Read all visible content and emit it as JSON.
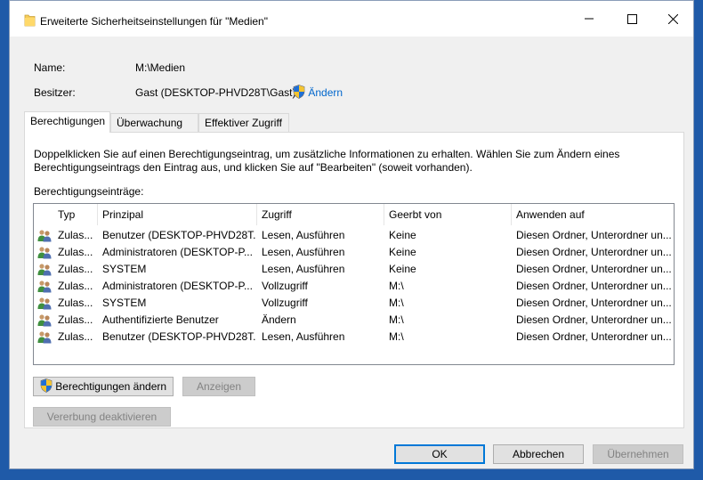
{
  "window": {
    "title": "Erweiterte Sicherheitseinstellungen für \"Medien\""
  },
  "info": {
    "name_label": "Name:",
    "name_value": "M:\\Medien",
    "owner_label": "Besitzer:",
    "owner_value": "Gast (DESKTOP-PHVD28T\\Gast)",
    "change_link": "Ändern"
  },
  "tabs": [
    {
      "label": "Berechtigungen",
      "active": true
    },
    {
      "label": "Überwachung",
      "active": false
    },
    {
      "label": "Effektiver Zugriff",
      "active": false
    }
  ],
  "description": {
    "line1": "Doppelklicken Sie auf einen Berechtigungseintrag, um zusätzliche Informationen zu erhalten. Wählen Sie zum Ändern eines",
    "line2": "Berechtigungseintrags den Eintrag aus, und klicken Sie auf \"Bearbeiten\" (soweit vorhanden)."
  },
  "entries_label": "Berechtigungseinträge:",
  "table": {
    "columns": [
      "Typ",
      "Prinzipal",
      "Zugriff",
      "Geerbt von",
      "Anwenden auf"
    ],
    "rows": [
      [
        "Zulas...",
        "Benutzer (DESKTOP-PHVD28T...",
        "Lesen, Ausführen",
        "Keine",
        "Diesen Ordner, Unterordner un..."
      ],
      [
        "Zulas...",
        "Administratoren (DESKTOP-P...",
        "Lesen, Ausführen",
        "Keine",
        "Diesen Ordner, Unterordner un..."
      ],
      [
        "Zulas...",
        "SYSTEM",
        "Lesen, Ausführen",
        "Keine",
        "Diesen Ordner, Unterordner un..."
      ],
      [
        "Zulas...",
        "Administratoren (DESKTOP-P...",
        "Vollzugriff",
        "M:\\",
        "Diesen Ordner, Unterordner un..."
      ],
      [
        "Zulas...",
        "SYSTEM",
        "Vollzugriff",
        "M:\\",
        "Diesen Ordner, Unterordner un..."
      ],
      [
        "Zulas...",
        "Authentifizierte Benutzer",
        "Ändern",
        "M:\\",
        "Diesen Ordner, Unterordner un..."
      ],
      [
        "Zulas...",
        "Benutzer (DESKTOP-PHVD28T...",
        "Lesen, Ausführen",
        "M:\\",
        "Diesen Ordner, Unterordner un..."
      ]
    ]
  },
  "buttons": {
    "change_permissions": "Berechtigungen ändern",
    "view": "Anzeigen",
    "disable_inheritance": "Vererbung deaktivieren",
    "ok": "OK",
    "cancel": "Abbrechen",
    "apply": "Übernehmen"
  },
  "colors": {
    "link": "#0066cc",
    "default_button_border": "#0078d7",
    "desktop_background": "#1f5aa8"
  },
  "icons": {
    "title": "folder-icon",
    "shield": "uac-shield-icon",
    "row": "users-icon"
  }
}
